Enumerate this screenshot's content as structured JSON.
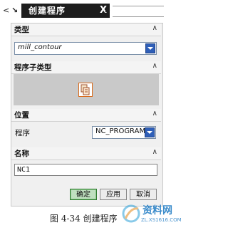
{
  "window": {
    "left_arrow": "<",
    "tab_title": "创建程序",
    "tab_close": "X",
    "right_arrow": ">"
  },
  "sections": {
    "type": {
      "label": "类型",
      "value": "mill_contour"
    },
    "subtype": {
      "label": "程序子类型",
      "selected_icon": "program-icon"
    },
    "location": {
      "label": "位置",
      "program_label": "程序",
      "program_value": "NC_PROGRAM"
    },
    "name": {
      "label": "名称",
      "value": "NC1"
    }
  },
  "buttons": {
    "ok": "确定",
    "apply": "应用",
    "cancel": "取消"
  },
  "caption": "图 4-34 创建程序",
  "watermark": {
    "brand": "资料网",
    "url": "ZL.XS1616.COM"
  },
  "colors": {
    "tab_bg": "#1d1d1d",
    "dropdown_btn": "#2f5fb8",
    "ok_button": "#bfe0bf",
    "subtype_icon_border": "#d96a1a"
  }
}
